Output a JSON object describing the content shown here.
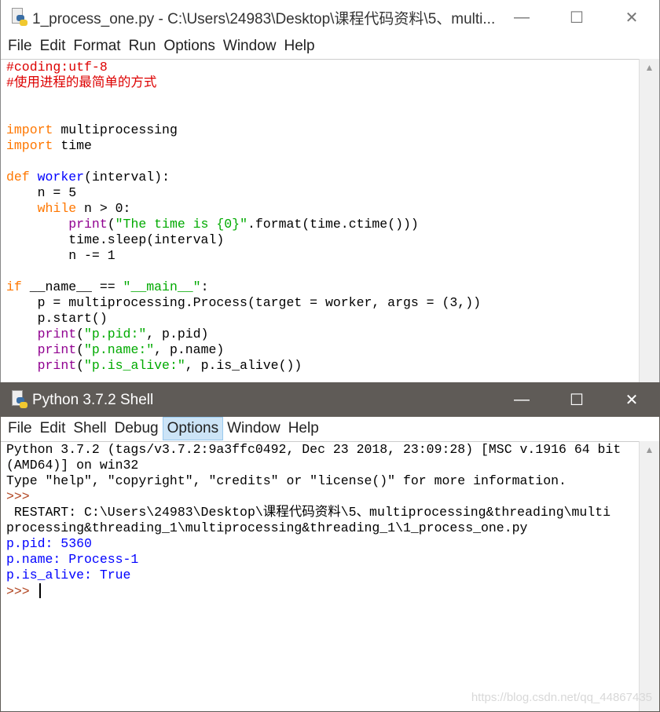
{
  "editor": {
    "title": "1_process_one.py - C:\\Users\\24983\\Desktop\\课程代码资料\\5、multi...",
    "menu": [
      "File",
      "Edit",
      "Format",
      "Run",
      "Options",
      "Window",
      "Help"
    ],
    "lines": [
      [
        [
          "#coding:utf-8",
          "comment"
        ]
      ],
      [
        [
          "#使用进程的最简单的方式",
          "comment"
        ]
      ],
      [],
      [],
      [
        [
          "import",
          "keyword"
        ],
        [
          " multiprocessing",
          "plain"
        ]
      ],
      [
        [
          "import",
          "keyword"
        ],
        [
          " time",
          "plain"
        ]
      ],
      [],
      [
        [
          "def",
          "keyword"
        ],
        [
          " ",
          "plain"
        ],
        [
          "worker",
          "defname"
        ],
        [
          "(interval):",
          "plain"
        ]
      ],
      [
        [
          "    n = 5",
          "plain"
        ]
      ],
      [
        [
          "    ",
          "plain"
        ],
        [
          "while",
          "keyword"
        ],
        [
          " n > 0:",
          "plain"
        ]
      ],
      [
        [
          "        ",
          "plain"
        ],
        [
          "print",
          "builtin"
        ],
        [
          "(",
          "plain"
        ],
        [
          "\"The time is {0}\"",
          "string"
        ],
        [
          ".format(time.ctime()))",
          "plain"
        ]
      ],
      [
        [
          "        time.sleep(interval)",
          "plain"
        ]
      ],
      [
        [
          "        n -= 1",
          "plain"
        ]
      ],
      [],
      [
        [
          "if",
          "keyword"
        ],
        [
          " __name__ == ",
          "plain"
        ],
        [
          "\"__main__\"",
          "string"
        ],
        [
          ":",
          "plain"
        ]
      ],
      [
        [
          "    p = multiprocessing.Process(target = worker, args = (3,))",
          "plain"
        ]
      ],
      [
        [
          "    p.start()",
          "plain"
        ]
      ],
      [
        [
          "    ",
          "plain"
        ],
        [
          "print",
          "builtin"
        ],
        [
          "(",
          "plain"
        ],
        [
          "\"p.pid:\"",
          "string"
        ],
        [
          ", p.pid)",
          "plain"
        ]
      ],
      [
        [
          "    ",
          "plain"
        ],
        [
          "print",
          "builtin"
        ],
        [
          "(",
          "plain"
        ],
        [
          "\"p.name:\"",
          "string"
        ],
        [
          ", p.name)",
          "plain"
        ]
      ],
      [
        [
          "    ",
          "plain"
        ],
        [
          "print",
          "builtin"
        ],
        [
          "(",
          "plain"
        ],
        [
          "\"p.is_alive:\"",
          "string"
        ],
        [
          ", p.is_alive())",
          "plain"
        ]
      ]
    ]
  },
  "shell": {
    "title": "Python 3.7.2 Shell",
    "menu": [
      "File",
      "Edit",
      "Shell",
      "Debug",
      "Options",
      "Window",
      "Help"
    ],
    "active_menu": "Options",
    "lines": [
      [
        [
          "Python 3.7.2 (tags/v3.7.2:9a3ffc0492, Dec 23 2018, 23:09:28) [MSC v.1916 64 bit",
          "plain"
        ]
      ],
      [
        [
          "(AMD64)] on win32",
          "plain"
        ]
      ],
      [
        [
          "Type \"help\", \"copyright\", \"credits\" or \"license()\" for more information.",
          "plain"
        ]
      ],
      [
        [
          ">>> ",
          "prompt"
        ]
      ],
      [
        [
          " RESTART: C:\\Users\\24983\\Desktop\\课程代码资料\\5、multiprocessing&threading\\multi",
          "plain"
        ]
      ],
      [
        [
          "processing&threading_1\\multiprocessing&threading_1\\1_process_one.py",
          "plain"
        ]
      ],
      [
        [
          "p.pid: 5360",
          "stdout"
        ]
      ],
      [
        [
          "p.name: Process-1",
          "stdout"
        ]
      ],
      [
        [
          "p.is_alive: True",
          "stdout"
        ]
      ],
      [
        [
          ">>> ",
          "prompt"
        ]
      ]
    ]
  },
  "controls": {
    "minimize": "—",
    "maximize": "☐",
    "close": "✕"
  },
  "watermark": "https://blog.csdn.net/qq_44867435"
}
